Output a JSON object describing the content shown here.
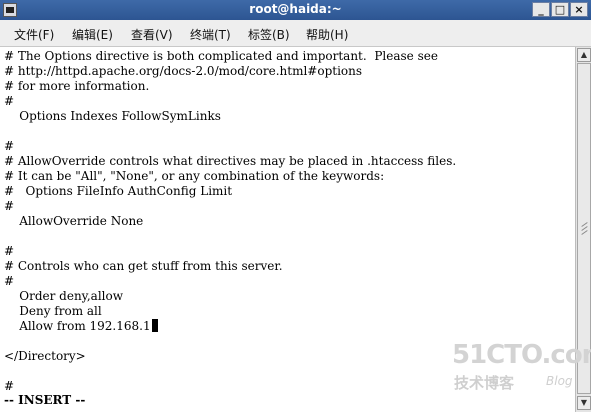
{
  "window": {
    "title": "root@haida:~",
    "buttons": {
      "minimize": "_",
      "maximize": "□",
      "close": "×"
    }
  },
  "menubar": {
    "items": [
      "文件(F)",
      "编辑(E)",
      "查看(V)",
      "终端(T)",
      "标签(B)",
      "帮助(H)"
    ]
  },
  "terminal": {
    "lines": [
      "# The Options directive is both complicated and important.  Please see",
      "# http://httpd.apache.org/docs-2.0/mod/core.html#options",
      "# for more information.",
      "#",
      "    Options Indexes FollowSymLinks",
      "",
      "#",
      "# AllowOverride controls what directives may be placed in .htaccess files.",
      "# It can be \"All\", \"None\", or any combination of the keywords:",
      "#   Options FileInfo AuthConfig Limit",
      "#",
      "    AllowOverride None",
      "",
      "#",
      "# Controls who can get stuff from this server.",
      "#",
      "    Order deny,allow",
      "    Deny from all",
      "    Allow from 192.168.1",
      "",
      "</Directory>",
      "",
      "#"
    ],
    "status": "-- INSERT --"
  },
  "watermark": {
    "logo": "51CTO.com",
    "subtitle": "技术博客",
    "blog": "Blog"
  }
}
